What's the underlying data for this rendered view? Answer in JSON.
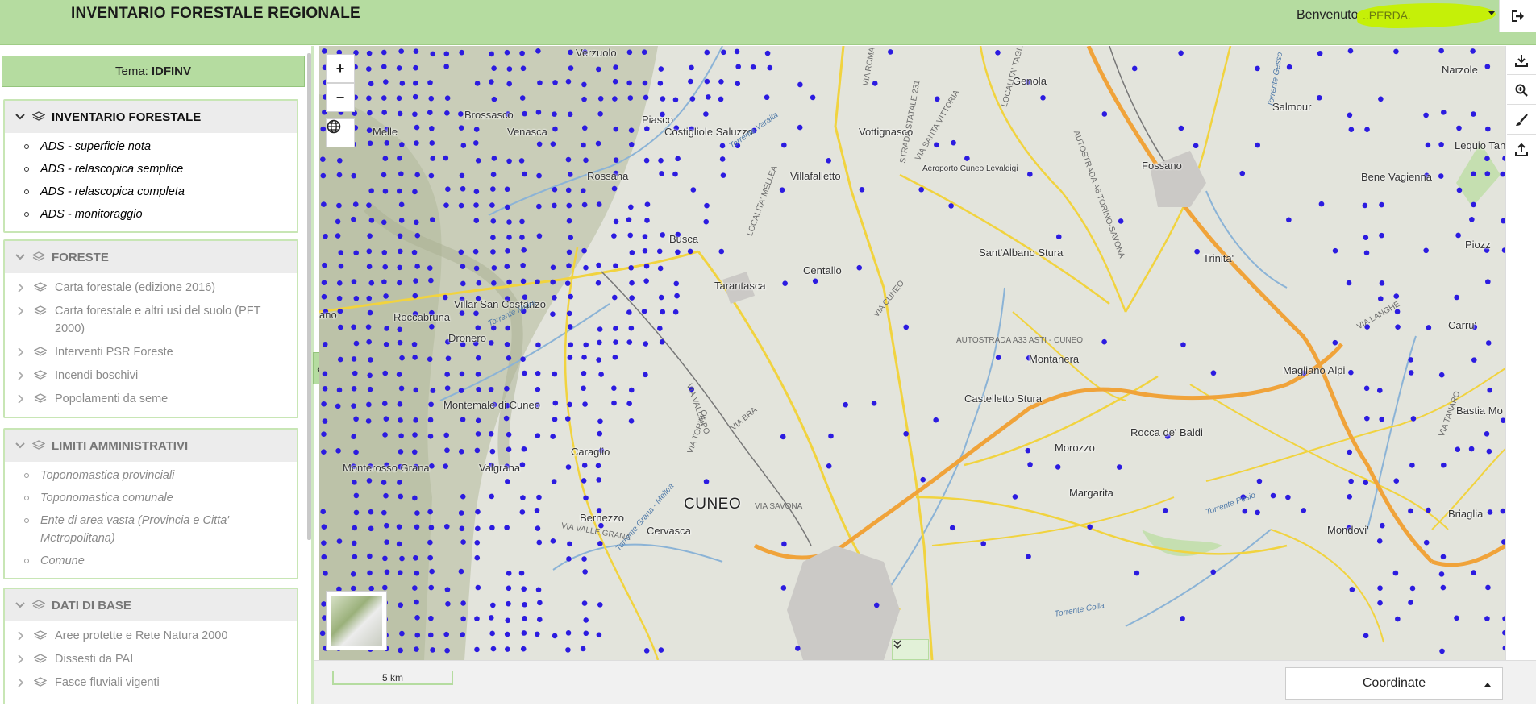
{
  "header": {
    "title": "INVENTARIO FORESTALE REGIONALE",
    "welcome_label": "Benvenuto",
    "username": "..PERDA.",
    "logout_icon": "sign-out-icon"
  },
  "sidebar": {
    "tema_label": "Tema:",
    "tema_value": "IDFINV",
    "groups": [
      {
        "title": "INVENTARIO FORESTALE",
        "items": [
          "ADS - superficie nota",
          "ADS - relascopica semplice",
          "ADS - relascopica completa",
          "ADS - monitoraggio"
        ]
      },
      {
        "title": "FORESTE",
        "items": [
          "Carta forestale (edizione 2016)",
          "Carta forestale e altri usi del suolo (PFT 2000)",
          "Interventi PSR Foreste",
          "Incendi boschivi",
          "Popolamenti da seme"
        ]
      },
      {
        "title": "LIMITI AMMINISTRATIVI",
        "items": [
          "Toponomastica provinciali",
          "Toponomastica comunale",
          "Ente di area vasta (Provincia e Citta' Metropolitana)",
          "Comune"
        ]
      },
      {
        "title": "DATI DI BASE",
        "items": [
          "Aree protette e Rete Natura 2000",
          "Dissesti da PAI",
          "Fasce fluviali vigenti"
        ]
      }
    ],
    "collapse_label": "«"
  },
  "map": {
    "zoom_in": "+",
    "zoom_out": "−",
    "places": [
      {
        "name": "Verzuolo"
      },
      {
        "name": "Brossasco"
      },
      {
        "name": "Melle"
      },
      {
        "name": "Venasca"
      },
      {
        "name": "Piasco"
      },
      {
        "name": "Costigliole Saluzzo"
      },
      {
        "name": "Rossana"
      },
      {
        "name": "Vottignasco"
      },
      {
        "name": "Villafalletto"
      },
      {
        "name": "Genola"
      },
      {
        "name": "Salmour"
      },
      {
        "name": "Narzole"
      },
      {
        "name": "Fossano"
      },
      {
        "name": "Bene Vagienna"
      },
      {
        "name": "Lequio Tana"
      },
      {
        "name": "Busca"
      },
      {
        "name": "Centallo"
      },
      {
        "name": "Tarantasca"
      },
      {
        "name": "Sant'Albano Stura"
      },
      {
        "name": "Trinita'"
      },
      {
        "name": "Piozz"
      },
      {
        "name": "Villar San Costanzo"
      },
      {
        "name": "Roccabruna"
      },
      {
        "name": "Dronero"
      },
      {
        "name": "Montanera"
      },
      {
        "name": "Carru'"
      },
      {
        "name": "Magliano Alpi"
      },
      {
        "name": "Castelletto Stura"
      },
      {
        "name": "Montemale di Cuneo"
      },
      {
        "name": "Bastia Mo"
      },
      {
        "name": "Caraglio"
      },
      {
        "name": "Rocca de' Baldi"
      },
      {
        "name": "Morozzo"
      },
      {
        "name": "Monterosso Grana"
      },
      {
        "name": "Valgrana"
      },
      {
        "name": "Margarita"
      },
      {
        "name": "Bernezzo"
      },
      {
        "name": "Cervasca"
      },
      {
        "name": "Mondovi'"
      },
      {
        "name": "Briaglia"
      },
      {
        "name": "Aeroporto Cuneo Levaldigi"
      },
      {
        "name": "ano"
      }
    ],
    "city": "CUNEO",
    "road_labels": [
      "AUTOSTRADA A33 ASTI - CUNEO",
      "AUTOSTRADA A6 TORINO-SAVONA",
      "VIA CUNEO",
      "VIA VALLE PO",
      "VIA SAVONA",
      "VIA VALLE GRANA",
      "VIA TORINO",
      "VIA BRA",
      "STRADA STATALE 231",
      "VIA ROMA",
      "LOCALITA' TAGLIATA",
      "VIA SANTA VITTORIA",
      "VIA LANGHE",
      "LOCALITA' MELLEA",
      "VIA TANARO"
    ],
    "river_labels": [
      "Torrente Varaita",
      "Torrente Maira",
      "Torrente Grana - Mellea",
      "Torrente Pesio",
      "Torrente Gesso",
      "Torrente Colla"
    ],
    "scale_label": "5 km",
    "expand_icon": "double-chevron-down-icon"
  },
  "tools": [
    "download-icon",
    "zoom-search-icon",
    "brush-icon",
    "upload-icon"
  ],
  "bottom": {
    "coordinates_label": "Coordinate"
  },
  "colors": {
    "header_green": "#b5dca0",
    "dot_blue": "#2c1be0",
    "highway_orange": "#f0a33a",
    "road_yellow": "#f1d33f"
  }
}
